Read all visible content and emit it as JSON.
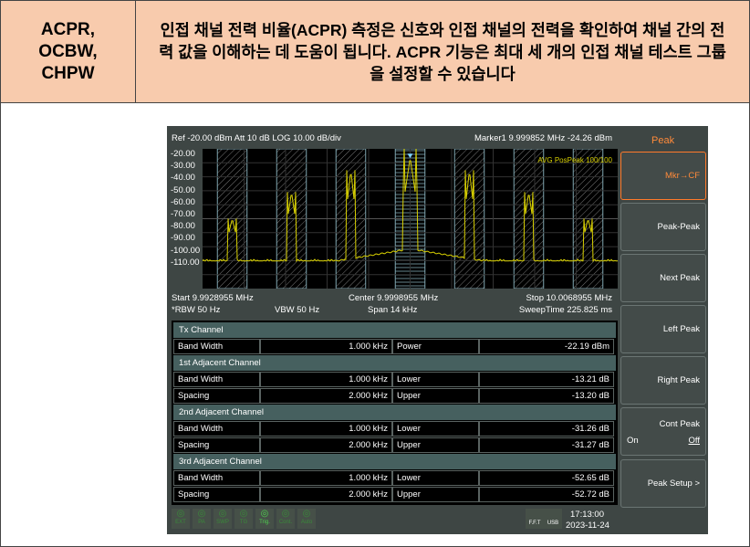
{
  "header": {
    "label": "ACPR,\nOCBW,\nCHPW",
    "description": "인접 채널 전력 비율(ACPR) 측정은 신호와 인접 채널의 전력을 확인하여 채널 간의 전력 값을 이해하는 데 도움이 됩니다. ACPR 기능은 최대 세 개의 인접 채널 테스트 그룹을 설정할 수 있습니다"
  },
  "analyzer": {
    "top_left": "Ref -20.00 dBm  Att 10 dB  LOG 10.00 dB/div",
    "marker": "Marker1 9.999852 MHz   -24.26 dBm",
    "trace_label": "AVG PosPeak 100/100",
    "start": "Start 9.9928955 MHz",
    "center": "Center 9.9998955 MHz",
    "stop": "Stop 10.0068955 MHz",
    "rbw": "*RBW 50 Hz",
    "vbw": "VBW 50 Hz",
    "span": "Span 14 kHz",
    "sweep": "SweepTime 225.825 ms",
    "y_ticks": [
      "-20.00",
      "-30.00",
      "-40.00",
      "-50.00",
      "-60.00",
      "-70.00",
      "-80.00",
      "-90.00",
      "-100.00",
      "-110.00"
    ],
    "trace": {
      "ref_dbm": -20,
      "db_per_div": 10,
      "span_khz": 14,
      "noise_dbm": -110,
      "peaks": [
        {
          "offset_khz": -6,
          "dbm": -75
        },
        {
          "offset_khz": -4,
          "dbm": -53
        },
        {
          "offset_khz": -2,
          "dbm": -35
        },
        {
          "offset_khz": 0,
          "dbm": -24.26
        },
        {
          "offset_khz": 2,
          "dbm": -35
        },
        {
          "offset_khz": 4,
          "dbm": -53
        },
        {
          "offset_khz": 6,
          "dbm": -75
        }
      ],
      "channel_bw_khz": 1,
      "spacing_khz": 2
    }
  },
  "table": [
    {
      "section": "Tx Channel"
    },
    {
      "cells": [
        "Band Width",
        "1.000 kHz",
        "Power",
        "-22.19 dBm"
      ]
    },
    {
      "section": "1st Adjacent Channel"
    },
    {
      "cells": [
        "Band Width",
        "1.000 kHz",
        "Lower",
        "-13.21 dB"
      ]
    },
    {
      "cells": [
        "Spacing",
        "2.000 kHz",
        "Upper",
        "-13.20 dB"
      ]
    },
    {
      "section": "2nd Adjacent Channel"
    },
    {
      "cells": [
        "Band Width",
        "1.000 kHz",
        "Lower",
        "-31.26 dB"
      ]
    },
    {
      "cells": [
        "Spacing",
        "2.000 kHz",
        "Upper",
        "-31.27 dB"
      ]
    },
    {
      "section": "3rd Adjacent Channel"
    },
    {
      "cells": [
        "Band Width",
        "1.000 kHz",
        "Lower",
        "-52.65 dB"
      ]
    },
    {
      "cells": [
        "Spacing",
        "2.000 kHz",
        "Upper",
        "-52.72 dB"
      ]
    }
  ],
  "softkeys": {
    "title": "Peak",
    "items": [
      "Mkr→CF",
      "Peak-Peak",
      "Next Peak",
      "Left Peak",
      "Right Peak"
    ],
    "cont_peak": "Cont Peak",
    "on": "On",
    "off": "Off",
    "setup": "Peak Setup  >"
  },
  "status": {
    "icons": [
      "EXT",
      "PA",
      "SWP",
      "TG",
      "Trig.",
      "Cont.",
      "Auto"
    ],
    "fft": "F.F.T",
    "usb": "USB",
    "time": "17:13:00",
    "date": "2023-11-24"
  }
}
